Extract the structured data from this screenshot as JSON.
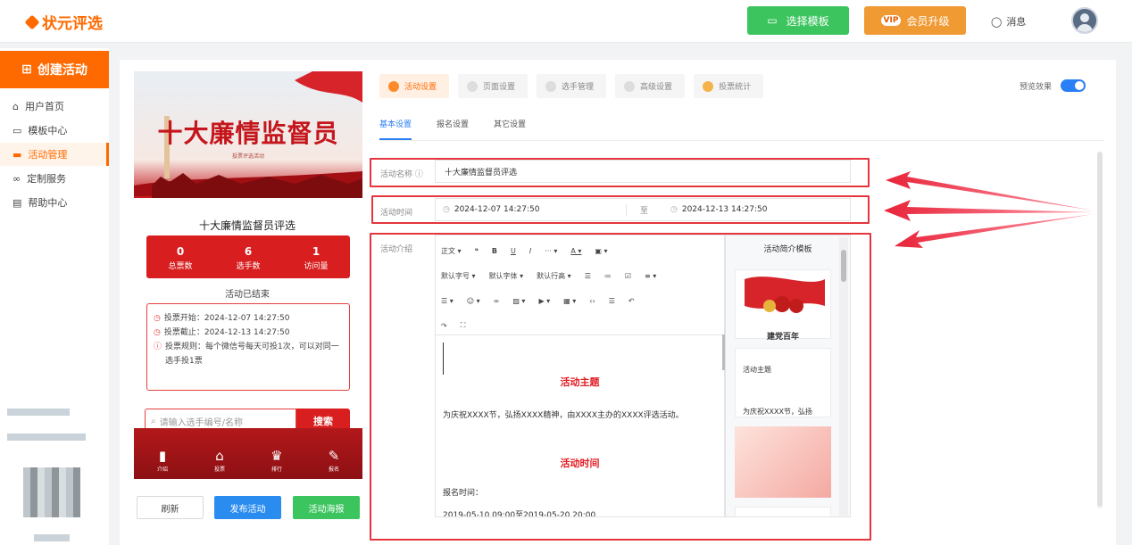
{
  "app": {
    "name": "状元评选"
  },
  "topbar": {
    "template_button": "选择模板",
    "vip_tag": "VIP",
    "vip_button": "会员升级",
    "messages": "消息"
  },
  "sidebar": {
    "create": "创建活动",
    "items": [
      {
        "label": "用户首页",
        "icon": "home-icon"
      },
      {
        "label": "模板中心",
        "icon": "folder-icon"
      },
      {
        "label": "活动管理",
        "icon": "ticket-icon"
      },
      {
        "label": "定制服务",
        "icon": "link-icon"
      },
      {
        "label": "帮助中心",
        "icon": "doc-icon"
      }
    ]
  },
  "preview": {
    "banner_title": "十大廉情监督员",
    "banner_sub": "投票评选活动",
    "activity_name": "十大廉情监督员评选",
    "stats": [
      {
        "value": "0",
        "label": "总票数"
      },
      {
        "value": "6",
        "label": "选手数"
      },
      {
        "value": "1",
        "label": "访问量"
      }
    ],
    "status": "活动已结束",
    "info": [
      "投票开始：2024-12-07 14:27:50",
      "投票截止：2024-12-13 14:27:50",
      "投票规则：每个微信号每天可投1次，可以对同一选手投1票"
    ],
    "search_placeholder": "请输入选手编号/名称",
    "search_button": "搜索",
    "tabs": [
      "介绍",
      "投票",
      "排行",
      "报名"
    ]
  },
  "actions": {
    "refresh": "刷新",
    "publish": "发布活动",
    "poster": "活动海报"
  },
  "main_tabs": [
    "活动设置",
    "页面设置",
    "选手管理",
    "高级设置",
    "投票统计"
  ],
  "preview_toggle": {
    "label": "预览效果",
    "on": true
  },
  "sub_tabs": [
    "基本设置",
    "报名设置",
    "其它设置"
  ],
  "form": {
    "name_label": "活动名称 ⓘ",
    "name_value": "十大廉情监督员评选",
    "time_label": "活动时间",
    "time_start": "2024-12-07 14:27:50",
    "time_sep": "至",
    "time_end": "2024-12-13 14:27:50",
    "intro_label": "活动介绍"
  },
  "editor": {
    "toolbar_row1": [
      "正文 ▾",
      "❝",
      "B",
      "U",
      "I",
      "··· ▾",
      "A ▾",
      "▣ ▾"
    ],
    "toolbar_row2": [
      "默认字号 ▾",
      "默认字体 ▾",
      "默认行高 ▾",
      "☰",
      "≔",
      "☑",
      "≡ ▾"
    ],
    "toolbar_row3": [
      "☰ ▾",
      "☺ ▾",
      "∞",
      "▨ ▾",
      "▶ ▾",
      "▦ ▾",
      "‹›",
      "☰",
      "↶"
    ],
    "toolbar_row4": [
      "↷",
      "⛶"
    ],
    "heading1": "活动主题",
    "para1": "为庆祝XXXX节，弘扬XXXX精神，由XXXX主办的XXXX评选活动。",
    "heading2": "活动时间",
    "para2": "报名时间：",
    "para3": "2019-05-10 09:00至2019-05-20 20:00"
  },
  "templates": {
    "title": "活动简介模板",
    "card1_caption": "建党百年",
    "card2_title": "活动主题",
    "card2_text": "为庆祝XXXX节，弘扬"
  }
}
